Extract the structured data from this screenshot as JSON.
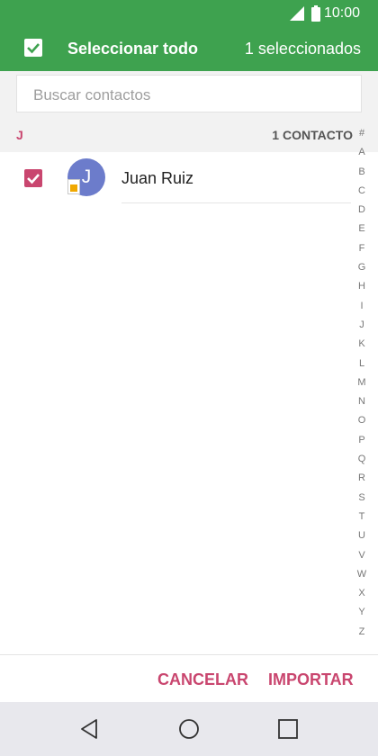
{
  "status_bar": {
    "time": "10:00"
  },
  "app_bar": {
    "select_all_label": "Seleccionar todo",
    "selected_count": "1 seleccionados"
  },
  "search": {
    "placeholder": "Buscar contactos"
  },
  "section": {
    "letter": "J",
    "count": "1 CONTACTO"
  },
  "contacts": [
    {
      "name": "Juan Ruiz",
      "initial": "J",
      "selected": true
    }
  ],
  "index_letters": [
    "#",
    "A",
    "B",
    "C",
    "D",
    "E",
    "F",
    "G",
    "H",
    "I",
    "J",
    "K",
    "L",
    "M",
    "N",
    "O",
    "P",
    "Q",
    "R",
    "S",
    "T",
    "U",
    "V",
    "W",
    "X",
    "Y",
    "Z"
  ],
  "actions": {
    "cancel": "CANCELAR",
    "import": "IMPORTAR"
  },
  "colors": {
    "primary": "#3ea24f",
    "accent": "#c9466f",
    "avatar": "#6c7ccb"
  },
  "icons": [
    "signal-icon",
    "battery-icon",
    "check-icon",
    "sim-card-icon",
    "back-icon",
    "home-icon",
    "recents-icon"
  ]
}
